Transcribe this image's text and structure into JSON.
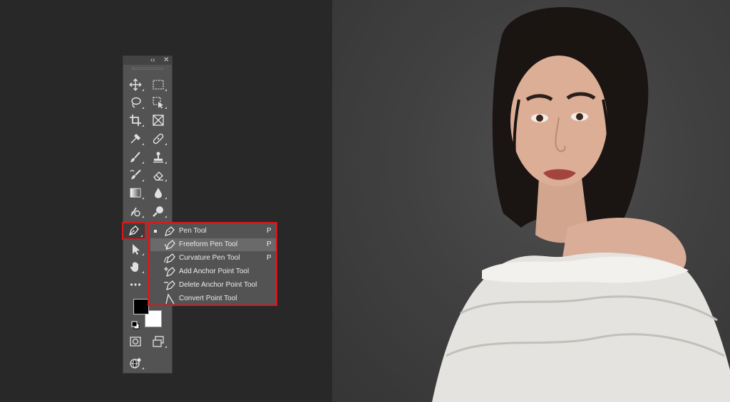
{
  "toolbar": {
    "collapse_label": "‹‹",
    "close_label": "✕",
    "tools": [
      {
        "name": "move-tool",
        "icon": "move-icon"
      },
      {
        "name": "marquee-tool",
        "icon": "rectangular-marquee-icon"
      },
      {
        "name": "lasso-tool",
        "icon": "lasso-icon"
      },
      {
        "name": "object-select-tool",
        "icon": "object-selection-icon"
      },
      {
        "name": "crop-tool",
        "icon": "crop-icon"
      },
      {
        "name": "frame-tool",
        "icon": "frame-icon"
      },
      {
        "name": "eyedropper-tool",
        "icon": "eyedropper-icon"
      },
      {
        "name": "healing-brush-tool",
        "icon": "bandage-icon"
      },
      {
        "name": "brush-tool",
        "icon": "brush-icon"
      },
      {
        "name": "clone-stamp-tool",
        "icon": "stamp-icon"
      },
      {
        "name": "history-brush-tool",
        "icon": "history-brush-icon"
      },
      {
        "name": "eraser-tool",
        "icon": "eraser-icon"
      },
      {
        "name": "gradient-tool",
        "icon": "gradient-icon"
      },
      {
        "name": "blur-tool",
        "icon": "drop-icon"
      },
      {
        "name": "dodge-tool",
        "icon": "dodge-icon"
      },
      {
        "name": "burn-tool",
        "icon": "magnifier-icon"
      },
      {
        "name": "pen-tool",
        "icon": "pen-icon"
      },
      {
        "name": "path-select-tool",
        "icon": "arrow-icon"
      },
      {
        "name": "hand-tool",
        "icon": "hand-icon"
      },
      {
        "name": "edit-toolbar",
        "icon": "more-icon"
      }
    ],
    "colors": {
      "foreground": "#000000",
      "background": "#ffffff"
    }
  },
  "flyout": {
    "items": [
      {
        "label": "Pen Tool",
        "shortcut": "P",
        "icon": "pen-icon",
        "active": true
      },
      {
        "label": "Freeform Pen Tool",
        "shortcut": "P",
        "icon": "freeform-pen-icon",
        "hover": true
      },
      {
        "label": "Curvature Pen Tool",
        "shortcut": "P",
        "icon": "curvature-pen-icon"
      },
      {
        "label": "Add Anchor Point Tool",
        "shortcut": "",
        "icon": "add-anchor-icon"
      },
      {
        "label": "Delete Anchor Point Tool",
        "shortcut": "",
        "icon": "delete-anchor-icon"
      },
      {
        "label": "Convert Point Tool",
        "shortcut": "",
        "icon": "convert-point-icon"
      }
    ]
  },
  "theme": {
    "accent": "#e0141a",
    "panel": "#535353",
    "workspace": "#282828"
  }
}
